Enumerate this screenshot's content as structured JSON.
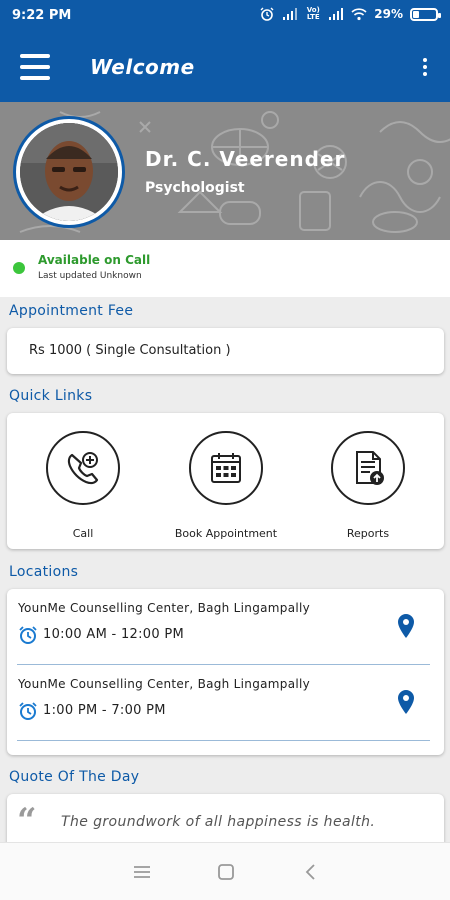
{
  "status_bar": {
    "time": "9:22 PM",
    "network_label": "Vo) LTE",
    "battery": "29%",
    "battery_level": 0.29,
    "icons": [
      "alarm-icon",
      "signal-icon",
      "volte-icon",
      "signal-icon",
      "wifi-icon",
      "battery-icon"
    ]
  },
  "app_bar": {
    "title": "Welcome",
    "menu_icon": "hamburger-icon",
    "overflow_icon": "more-vert-icon"
  },
  "profile": {
    "name": "Dr. C. Veerender",
    "role": "Psychologist"
  },
  "availability": {
    "status": "Available on Call",
    "updated": "Last updated Unknown",
    "status_color": "#3cc63c"
  },
  "fee": {
    "section_title": "Appointment Fee",
    "text": "Rs 1000 ( Single Consultation )"
  },
  "quick_links": {
    "section_title": "Quick Links",
    "items": [
      {
        "label": "Call",
        "icon": "phone-plus-icon"
      },
      {
        "label": "Book Appointment",
        "icon": "calendar-icon"
      },
      {
        "label": "Reports",
        "icon": "report-upload-icon"
      }
    ]
  },
  "locations": {
    "section_title": "Locations",
    "items": [
      {
        "name": "YounMe Counselling Center, Bagh Lingampally",
        "time": "10:00 AM - 12:00 PM"
      },
      {
        "name": "YounMe Counselling Center, Bagh Lingampally",
        "time": "1:00 PM - 7:00 PM"
      }
    ]
  },
  "quote": {
    "section_title": "Quote Of The Day",
    "text": "The groundwork of all happiness is health."
  },
  "colors": {
    "primary": "#0e5aa7",
    "available_green": "#2e9a2e",
    "background": "#ededed"
  }
}
